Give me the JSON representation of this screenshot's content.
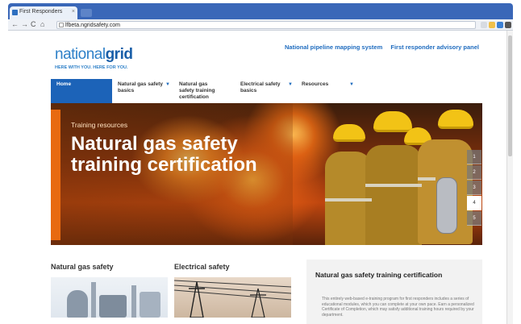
{
  "browser": {
    "tab_title": "First Responders",
    "tab_close": "×",
    "url": "lfbeta.ngridsafety.com",
    "back": "←",
    "forward": "→",
    "reload": "C",
    "home": "⌂"
  },
  "header": {
    "logo_light": "national",
    "logo_bold": "grid",
    "tagline": "HERE WITH YOU. HERE FOR YOU.",
    "links": [
      "National pipeline mapping system",
      "First responder advisory panel"
    ]
  },
  "nav": {
    "items": [
      {
        "label": "Home",
        "caret": ""
      },
      {
        "label": "Natural gas safety basics",
        "caret": "▼"
      },
      {
        "label": "Natural gas safety training certification",
        "caret": ""
      },
      {
        "label": "Electrical safety basics",
        "caret": "▼"
      },
      {
        "label": "Resources",
        "caret": "▼"
      }
    ]
  },
  "hero": {
    "kicker": "Training resources",
    "title": "Natural gas safety training certification",
    "pages": [
      "1",
      "2",
      "3",
      "4",
      "5"
    ],
    "active_page": "4"
  },
  "sections": {
    "gas_title": "Natural gas safety",
    "elec_title": "Electrical safety",
    "cert_title": "Natural gas safety training certification",
    "cert_body": "This entirely web-based e-training program for first responders includes a series of educational modules, which you can complete at your own pace. Earn a personalized Certificate of Completion, which may satisfy additional training hours required by your department."
  },
  "colors": {
    "brand_blue": "#1c63b8",
    "link_blue": "#1f6cbf",
    "accent_orange": "#e86a10"
  }
}
